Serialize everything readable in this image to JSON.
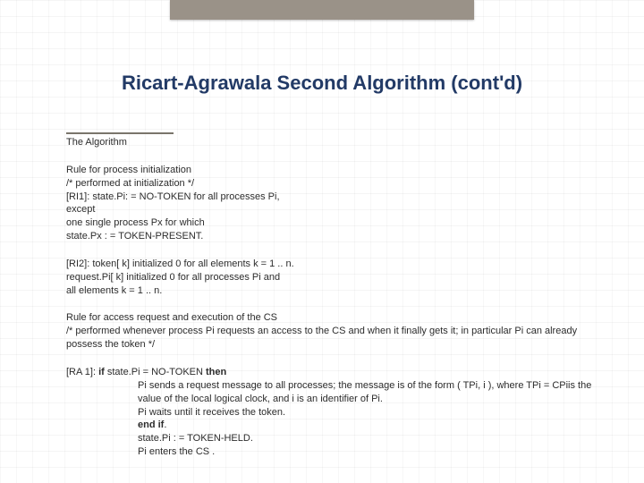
{
  "title": "Ricart-Agrawala Second Algorithm (cont'd)",
  "section_heading": "The Algorithm",
  "para_ri1": {
    "l1": "Rule for process initialization",
    "l2": "/* performed at initialization */",
    "l3": "[RI1]: state.Pi: = NO-TOKEN for all processes Pi, except",
    "l4": "one single process Px for which",
    "l5": "state.Px : = TOKEN-PRESENT."
  },
  "para_ri2": {
    "l1": "[RI2]: token[ k] initialized 0 for all elements k = 1 .. n.",
    "l2": "request.Pi[ k] initialized 0 for all processes Pi and",
    "l3": "all elements k = 1 .. n."
  },
  "para_access": {
    "l1": "Rule for access request and execution of the CS",
    "l2": "/* performed whenever process Pi requests an access to the CS and when it finally gets it; in particular Pi can already possess the token */"
  },
  "ra1": {
    "head_prefix": "[RA 1]: ",
    "if_kw": "if",
    "head_mid": " state.Pi = NO-TOKEN ",
    "then_kw": "then",
    "b1": "Pi sends a request message to all processes; the message is of the form ( TPi, i ), where TPi = CPiis the value of the local logical clock, and i is an identifier of Pi.",
    "b2": "Pi waits until it receives the token.",
    "b3_kw": "end if",
    "b3_tail": ".",
    "b4": "state.Pi : = TOKEN-HELD.",
    "b5": "Pi enters the CS ."
  }
}
